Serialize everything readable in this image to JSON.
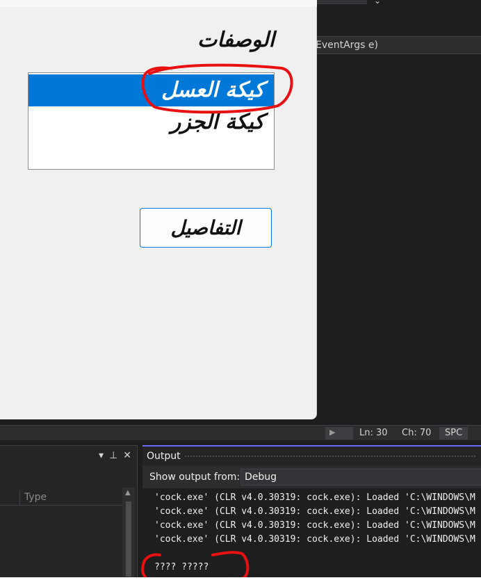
{
  "editor": {
    "signature_text": "EventArgs e)"
  },
  "form": {
    "description_label": "الوصفات",
    "list_items": [
      {
        "label": "كيكة العسل",
        "selected": true
      },
      {
        "label": "كيكة الجزر",
        "selected": false
      }
    ],
    "details_button": "التفاصيل"
  },
  "statusbar": {
    "line": "Ln: 30",
    "char": "Ch: 70",
    "mode": "SPC"
  },
  "left_panel": {
    "column_type": "Type",
    "tools": [
      "dropdown-icon",
      "pin-icon",
      "close-icon"
    ]
  },
  "output": {
    "title": "Output",
    "show_from_label": "Show output from:",
    "source": "Debug",
    "lines": [
      "'cock.exe' (CLR v4.0.30319: cock.exe): Loaded 'C:\\WINDOWS\\M",
      "'cock.exe' (CLR v4.0.30319: cock.exe): Loaded 'C:\\WINDOWS\\M",
      "'cock.exe' (CLR v4.0.30319: cock.exe): Loaded 'C:\\WINDOWS\\M",
      "'cock.exe' (CLR v4.0.30319: cock.exe): Loaded 'C:\\WINDOWS\\M",
      " ???? ?????"
    ]
  },
  "colors": {
    "selection": "#0078d7",
    "annotation_red": "#e81010",
    "output_accent": "#6a6aff"
  }
}
